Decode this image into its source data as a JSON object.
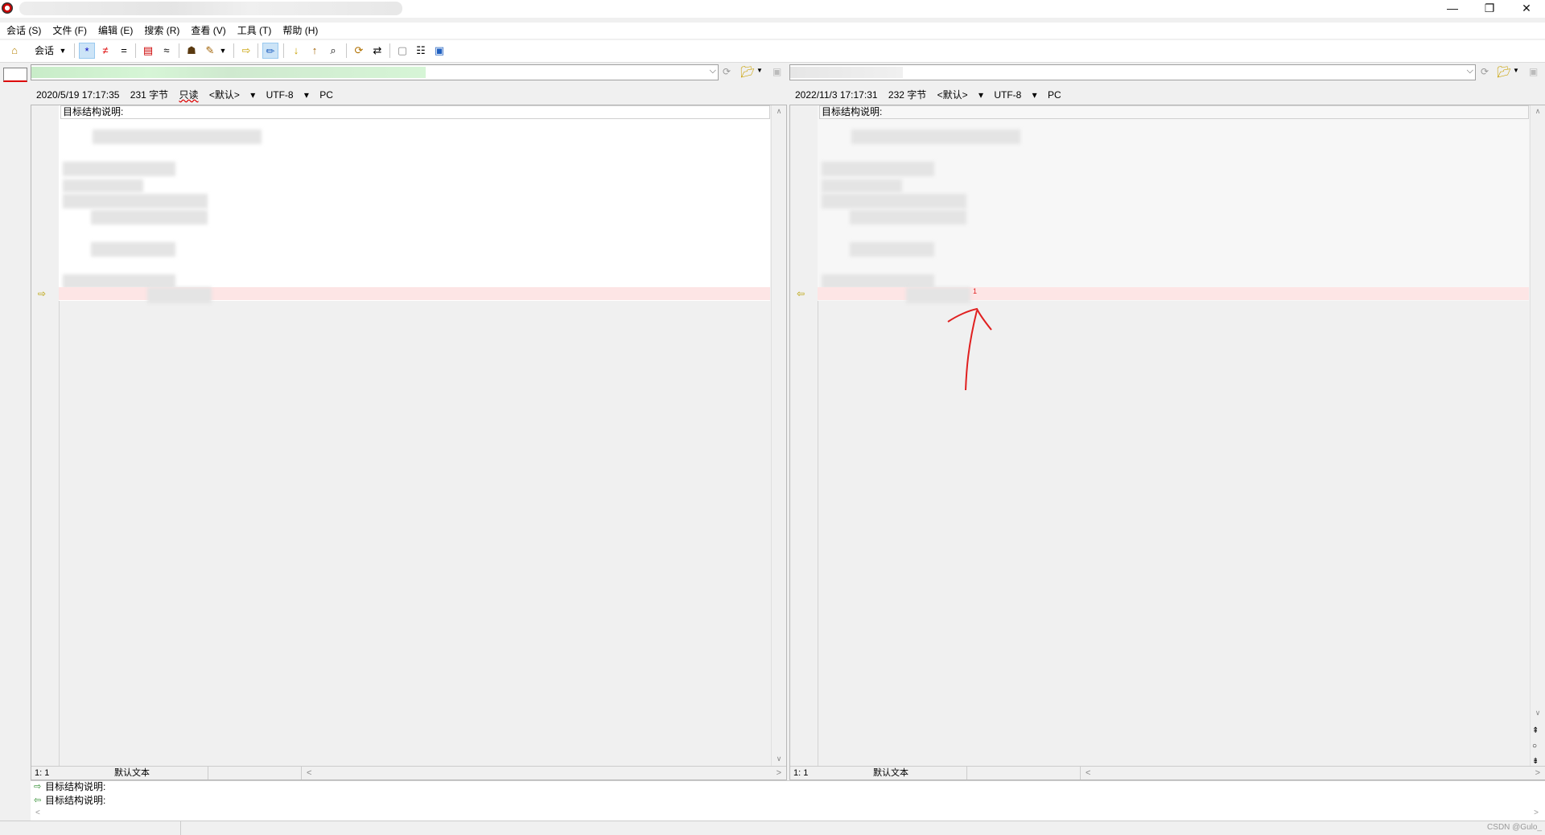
{
  "window": {
    "minimize_glyph": "—",
    "restore_glyph": "❐",
    "close_glyph": "✕"
  },
  "menu": [
    "会话 (S)",
    "文件 (F)",
    "编辑 (E)",
    "搜索 (R)",
    "查看 (V)",
    "工具 (T)",
    "帮助 (H)"
  ],
  "toolbar": {
    "session_label": "会话",
    "icons": [
      "home-icon",
      "session-dropdown-icon",
      "show-all-icon",
      "show-diff-icon",
      "show-same-icon",
      "compare-icon",
      "rules-icon",
      "user-icon",
      "format-icon",
      "next-section-icon",
      "edit-icon",
      "next-diff-icon",
      "prev-diff-icon",
      "find-icon",
      "refresh-icon",
      "swap-icon",
      "expand-icon",
      "details-icon",
      "save-icon"
    ]
  },
  "left": {
    "info": {
      "date": "2020/5/19 17:17:35",
      "size": "231 字节",
      "readonly": "只读",
      "default": "<默认>",
      "encoding": "UTF-8",
      "eol": "PC"
    },
    "first_line": "目标结构说明:",
    "status_pos": "1: 1",
    "status_mode": "默认文本"
  },
  "right": {
    "info": {
      "date": "2022/11/3 17:17:31",
      "size": "232 字节",
      "default": "<默认>",
      "encoding": "UTF-8",
      "eol": "PC"
    },
    "first_line": "目标结构说明:",
    "diff_char": "1",
    "status_pos": "1: 1",
    "status_mode": "默认文本"
  },
  "compare": {
    "line_left": "目标结构说明:",
    "line_right": "目标结构说明:"
  },
  "watermark": "CSDN @Gulo_",
  "colors": {
    "diff_bg": "#fde5e5",
    "path_left_bg": "#d6f5d6",
    "annotation": "#e02020"
  }
}
